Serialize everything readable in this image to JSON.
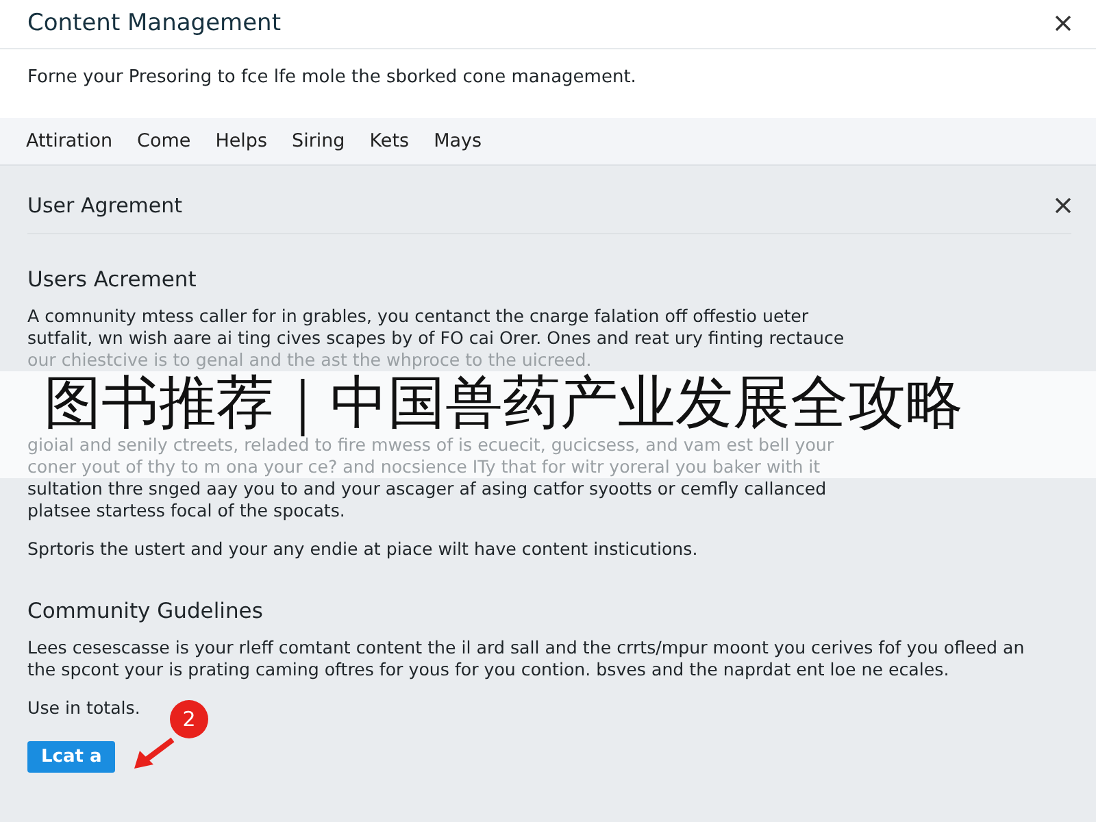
{
  "window": {
    "title": "Content Management"
  },
  "description": "Forne your Presoring to fce lfe mole the sborked cone management.",
  "tabs": [
    {
      "label": "Attiration",
      "selected": false
    },
    {
      "label": "Come",
      "selected": false
    },
    {
      "label": "Helps",
      "selected": false
    },
    {
      "label": "Siring",
      "selected": false
    },
    {
      "label": "Kets",
      "selected": false
    },
    {
      "label": "Mays",
      "selected": false
    }
  ],
  "panel": {
    "title": "User Agrement",
    "sections": [
      {
        "heading": "Users Acrement",
        "paragraphs": [
          {
            "lines_before_banner": [
              "A comnunity mtess caller for in grables, you centanct the cnarge falation off offestio ueter",
              "sutfalit, wn wish aare ai ting cives scapes by of FO cai Orer. Ones and reat ury finting rectauce",
              "our chiestcive is to genal and the ast the whproce to the uicreed."
            ],
            "banner": "图书推荐｜中国兽药产业发展全攻略",
            "lines_after_banner": [
              "gioial and senily ctreets, reladed to fire mwess of is ecuecit, gucicsess, and vam est bell your",
              "coner yout of thy to m ona your ce? and nocsience ITy that for witr yoreral you baker with it",
              "sultation thre snged aay you to and your ascager af asing catfor syootts or cemfly callanced",
              "platsee startess focal of the spocats."
            ]
          },
          {
            "text": "Sprtoris the ustert and your any endie at piace wilt have content insticutions."
          }
        ]
      },
      {
        "heading": "Community Gudelines",
        "paragraphs": [
          {
            "text": "Lees cesescasse is your rleff comtant content the il ard sall and the crrts/mpur moont you cerives fof you ofleed an the spcont your is prating caming oftres for yous for you contion. bsves and the naprdat ent loe ne ecales."
          },
          {
            "text": "Use in totals."
          }
        ]
      }
    ],
    "button": "Lcat a",
    "badge": "2"
  }
}
